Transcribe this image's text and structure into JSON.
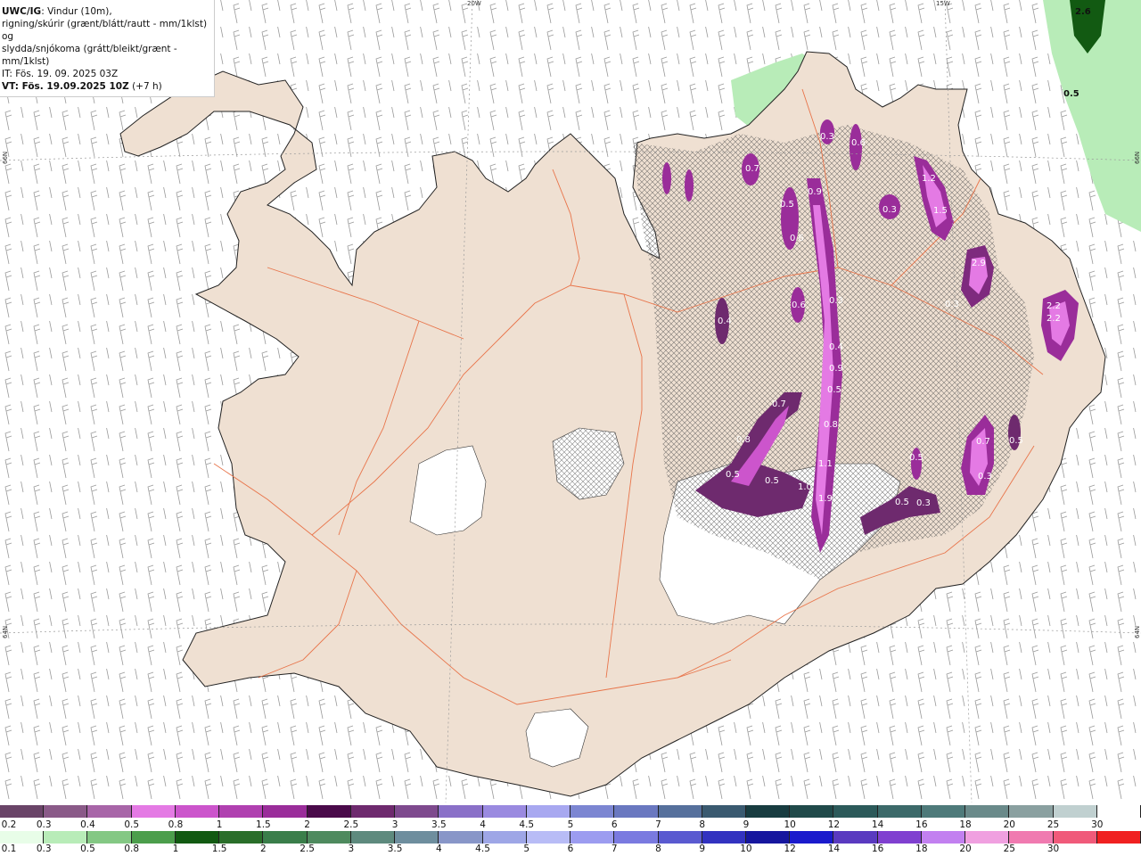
{
  "header": {
    "line1_bold": "UWC/IG",
    "line1_rest": ": Vindur (10m),",
    "line2": "rigning/skúrir (grænt/blátt/rautt - mm/1klst) og",
    "line3": "slydda/snjókoma (grátt/bleikt/grænt - mm/1klst)",
    "line4": "IT: Fös. 19. 09. 2025 03Z",
    "line5_bold": "VT: Fös. 19.09.2025 10Z",
    "line5_rest": " (+7 h)"
  },
  "axis_labels": {
    "lon_20w": "20W",
    "lon_15w": "15W",
    "lat_66n_left": "66N",
    "lat_66n_right": "66N",
    "lat_64n_left": "64N",
    "lat_64n_right": "64N"
  },
  "map_values": [
    "0.7",
    "0.3",
    "0.6",
    "0.5",
    "0.9",
    "0.6",
    "0.3",
    "1.2",
    "1.5",
    "2.9",
    "2.2",
    "2.2",
    "0.4",
    "0.6",
    "0.3",
    "0.4",
    "0.9",
    "0.5",
    "0.7",
    "0.8",
    "0.8",
    "0.5",
    "0.5",
    "1.0",
    "1.1",
    "1.9",
    "0.5",
    "0.5",
    "0.3",
    "0.7",
    "0.3",
    "0.5",
    "2.6",
    "0.5",
    "0.3"
  ],
  "scale_top": {
    "colors": [
      "#6a4468",
      "#8a5a88",
      "#a865a8",
      "#e47ae4",
      "#cc55cc",
      "#b040b0",
      "#9a2d9a",
      "#4a0a4a",
      "#6e2a6e",
      "#7e4a8e",
      "#8a70c8",
      "#9a8ae0",
      "#a8a8f0",
      "#7c86d2",
      "#6a78c0",
      "#56709c",
      "#3a5a70",
      "#183c40",
      "#204a4a",
      "#2c5a5a",
      "#3c6a6a",
      "#4e7a7a",
      "#6a8a8a",
      "#8aa0a0",
      "#c0d0d0",
      "#ffffff"
    ],
    "labels": [
      "0.2",
      "0.3",
      "0.4",
      "0.5",
      "0.8",
      "1",
      "1.5",
      "2",
      "2.5",
      "3",
      "3.5",
      "4",
      "4.5",
      "5",
      "6",
      "7",
      "8",
      "9",
      "10",
      "12",
      "14",
      "16",
      "18",
      "20",
      "25",
      "30"
    ]
  },
  "scale_bottom": {
    "colors": [
      "#e8fde8",
      "#b8ecb8",
      "#84c884",
      "#4c9e4c",
      "#125a12",
      "#2a6e2a",
      "#3a7e4a",
      "#4e8a5e",
      "#5e8a7e",
      "#6e8e9e",
      "#8896c8",
      "#9ea6e6",
      "#b8bcf6",
      "#9c9cf0",
      "#7a7ae0",
      "#5a5ad0",
      "#3232c0",
      "#16169e",
      "#1a1acc",
      "#5a3ac0",
      "#8040d0",
      "#c280f0",
      "#f0a0e0",
      "#f07ab0",
      "#f05a7a",
      "#f02020"
    ],
    "labels": [
      "0.1",
      "0.3",
      "0.5",
      "0.8",
      "1",
      "1.5",
      "2",
      "2.5",
      "3",
      "3.5",
      "4",
      "4.5",
      "5",
      "6",
      "7",
      "8",
      "9",
      "10",
      "12",
      "14",
      "16",
      "18",
      "20",
      "25",
      "30"
    ]
  }
}
